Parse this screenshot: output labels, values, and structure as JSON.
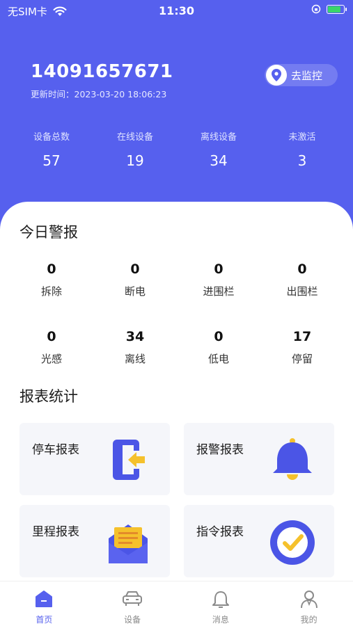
{
  "status_bar": {
    "carrier": "无SIM卡",
    "time": "11:30"
  },
  "header": {
    "account": "14091657671",
    "updated_label": "更新时间：",
    "updated_time": "2023-03-20 18:06:23",
    "monitor_button": "去监控"
  },
  "device_stats": [
    {
      "label": "设备总数",
      "value": "57"
    },
    {
      "label": "在线设备",
      "value": "19"
    },
    {
      "label": "离线设备",
      "value": "34"
    },
    {
      "label": "未激活",
      "value": "3"
    }
  ],
  "alarms": {
    "title": "今日警报",
    "items": [
      {
        "num": "0",
        "name": "拆除"
      },
      {
        "num": "0",
        "name": "断电"
      },
      {
        "num": "0",
        "name": "进围栏"
      },
      {
        "num": "0",
        "name": "出围栏"
      },
      {
        "num": "0",
        "name": "光感"
      },
      {
        "num": "34",
        "name": "离线"
      },
      {
        "num": "0",
        "name": "低电"
      },
      {
        "num": "17",
        "name": "停留"
      }
    ]
  },
  "reports": {
    "title": "报表统计",
    "items": [
      {
        "label": "停车报表",
        "icon": "parking-exit-icon"
      },
      {
        "label": "报警报表",
        "icon": "bell-icon"
      },
      {
        "label": "里程报表",
        "icon": "envelope-icon"
      },
      {
        "label": "指令报表",
        "icon": "check-circle-icon"
      }
    ]
  },
  "tabbar": [
    {
      "label": "首页",
      "icon": "home-icon",
      "active": true
    },
    {
      "label": "设备",
      "icon": "car-icon",
      "active": false
    },
    {
      "label": "消息",
      "icon": "bell-outline-icon",
      "active": false
    },
    {
      "label": "我的",
      "icon": "user-icon",
      "active": false
    }
  ],
  "colors": {
    "primary": "#5660ee",
    "card_bg": "#f5f6fa",
    "bell": "#4b55e6",
    "accent_yellow": "#f5c12c"
  }
}
